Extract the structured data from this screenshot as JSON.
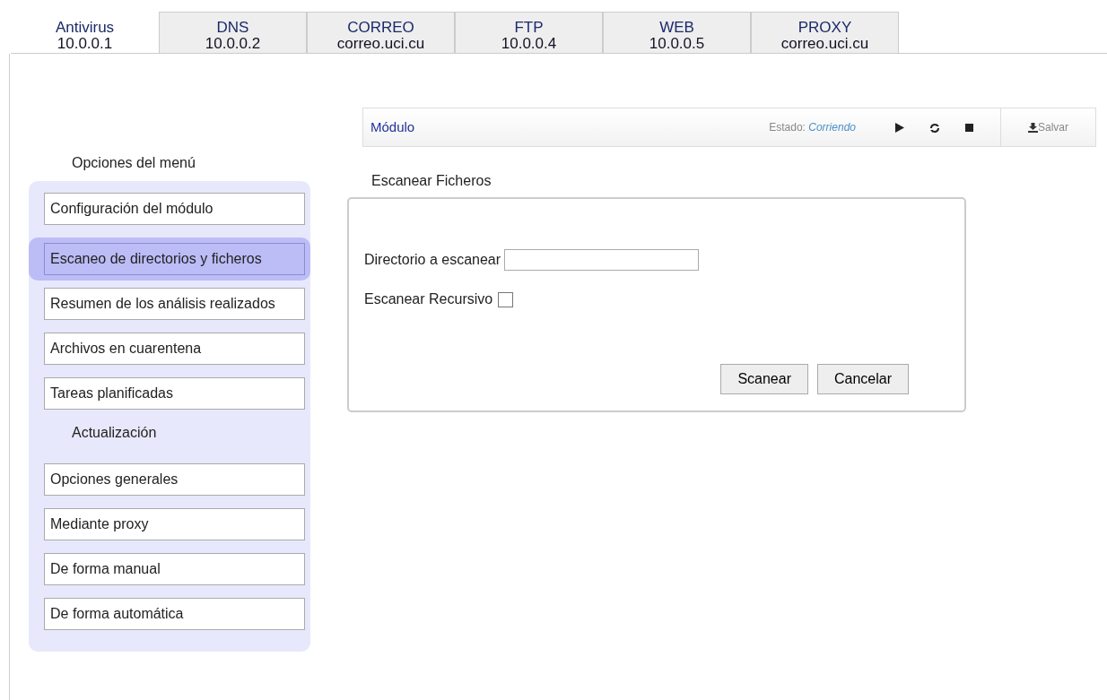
{
  "tabs": [
    {
      "name": "Antivirus",
      "address": "10.0.0.1",
      "selected": true
    },
    {
      "name": "DNS",
      "address": "10.0.0.2",
      "selected": false
    },
    {
      "name": "CORREO",
      "address": "correo.uci.cu",
      "selected": false
    },
    {
      "name": "FTP",
      "address": "10.0.0.4",
      "selected": false
    },
    {
      "name": "WEB",
      "address": "10.0.0.5",
      "selected": false
    },
    {
      "name": "PROXY",
      "address": "correo.uci.cu",
      "selected": false
    }
  ],
  "menu": {
    "title": "Opciones del menú",
    "items": [
      {
        "kind": "item",
        "label": "Configuración del módulo",
        "selected": false
      },
      {
        "kind": "item",
        "label": "Escaneo de directorios y ficheros",
        "selected": true
      },
      {
        "kind": "item",
        "label": "Resumen de los análisis realizados",
        "selected": false
      },
      {
        "kind": "item",
        "label": "Archivos en cuarentena",
        "selected": false
      },
      {
        "kind": "item",
        "label": "Tareas planificadas",
        "selected": false
      },
      {
        "kind": "heading",
        "label": "Actualización"
      },
      {
        "kind": "item",
        "label": "Opciones generales",
        "selected": false
      },
      {
        "kind": "item",
        "label": "Mediante proxy",
        "selected": false
      },
      {
        "kind": "item",
        "label": "De forma manual",
        "selected": false
      },
      {
        "kind": "item",
        "label": "De forma automática",
        "selected": false
      }
    ]
  },
  "module_bar": {
    "title": "Módulo",
    "status_label": "Estado:",
    "status_value": "Corriendo",
    "save": "Salvar"
  },
  "form": {
    "legend": "Escanear Ficheros",
    "directory_label": "Directorio a escanear",
    "recursive_label": "Escanear Recursivo",
    "recursive_checked": false,
    "buttons": [
      "Scanear",
      "Cancelar"
    ]
  }
}
